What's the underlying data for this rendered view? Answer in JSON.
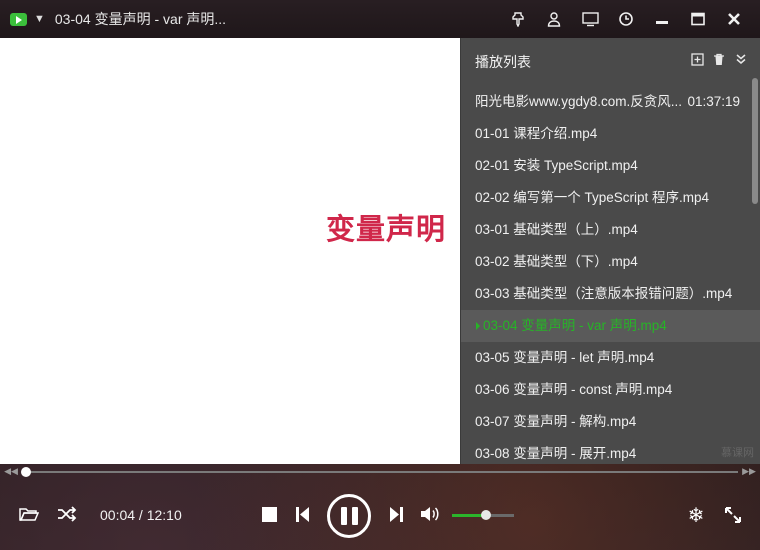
{
  "window": {
    "title": "03-04 变量声明 - var 声明..."
  },
  "video": {
    "caption": "变量声明"
  },
  "playlist": {
    "title": "播放列表",
    "items": [
      {
        "label": "阳光电影www.ygdy8.com.反贪风...",
        "duration": "01:37:19",
        "active": false
      },
      {
        "label": "01-01 课程介绍.mp4",
        "active": false
      },
      {
        "label": "02-01 安装 TypeScript.mp4",
        "active": false
      },
      {
        "label": "02-02 编写第一个 TypeScript 程序.mp4",
        "active": false
      },
      {
        "label": "03-01 基础类型（上）.mp4",
        "active": false
      },
      {
        "label": "03-02 基础类型（下）.mp4",
        "active": false
      },
      {
        "label": "03-03 基础类型（注意版本报错问题）.mp4",
        "active": false
      },
      {
        "label": "03-04 变量声明 - var 声明.mp4",
        "active": true
      },
      {
        "label": "03-05 变量声明 - let 声明.mp4",
        "active": false
      },
      {
        "label": "03-06 变量声明 - const 声明.mp4",
        "active": false
      },
      {
        "label": "03-07 变量声明 - 解构.mp4",
        "active": false
      },
      {
        "label": "03-08 变量声明 - 展开.mp4",
        "active": false
      }
    ],
    "watermark": "慕课网"
  },
  "player": {
    "time_current": "00:04",
    "time_total": "12:10",
    "time_display": "00:04 / 12:10",
    "progress_fraction": 0.0055,
    "volume_fraction": 0.55,
    "accent_color": "#2bb52b"
  },
  "icons": {
    "titlebar": [
      "pin-icon",
      "user-icon",
      "monitor-icon",
      "clock-icon",
      "minimize-icon",
      "maximize-icon",
      "close-icon"
    ],
    "playlist": [
      "add-icon",
      "trash-icon",
      "collapse-icon"
    ],
    "controls": [
      "open-folder-icon",
      "shuffle-icon",
      "stop-icon",
      "previous-icon",
      "pause-icon",
      "next-icon",
      "volume-icon",
      "snowflake-icon",
      "fullscreen-icon"
    ]
  }
}
